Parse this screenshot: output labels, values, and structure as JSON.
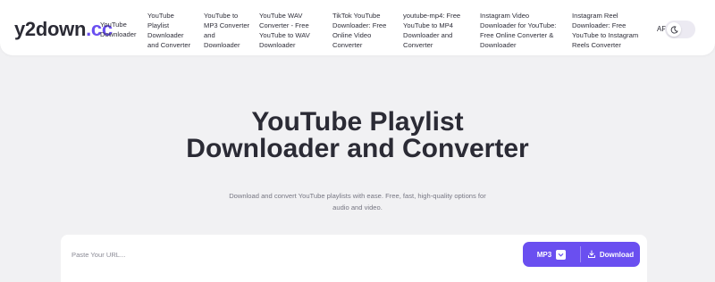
{
  "brand": {
    "logo_primary": "y2down",
    "logo_secondary": ".cc",
    "accent_color": "#6a4ff0"
  },
  "nav": {
    "links": [
      {
        "label": "YouTube Downloader"
      },
      {
        "label": "YouTube Playlist Downloader and Converter"
      },
      {
        "label": "YouTube to MP3 Converter and Downloader"
      },
      {
        "label": "YouTube WAV Converter - Free YouTube to WAV Downloader"
      },
      {
        "label": "TikTok YouTube Downloader: Free Online Video Converter"
      },
      {
        "label": "youtube-mp4: Free YouTube to MP4 Downloader and Converter"
      },
      {
        "label": "Instagram Video Downloader for YouTube: Free Online Converter & Downloader"
      },
      {
        "label": "Instagram Reel Downloader: Free YouTube to Instagram Reels Converter"
      }
    ],
    "api_label": "API",
    "theme_icon": "moon-icon"
  },
  "hero": {
    "title": "YouTube Playlist Downloader and Converter",
    "subtitle": "Download and convert YouTube playlists with ease. Free, fast, high-quality options for audio and video."
  },
  "search": {
    "placeholder": "Paste Your URL...",
    "value": "",
    "format_label": "MP3",
    "download_label": "Download",
    "download_icon": "download-icon",
    "format_icon": "chevron-down-icon"
  }
}
